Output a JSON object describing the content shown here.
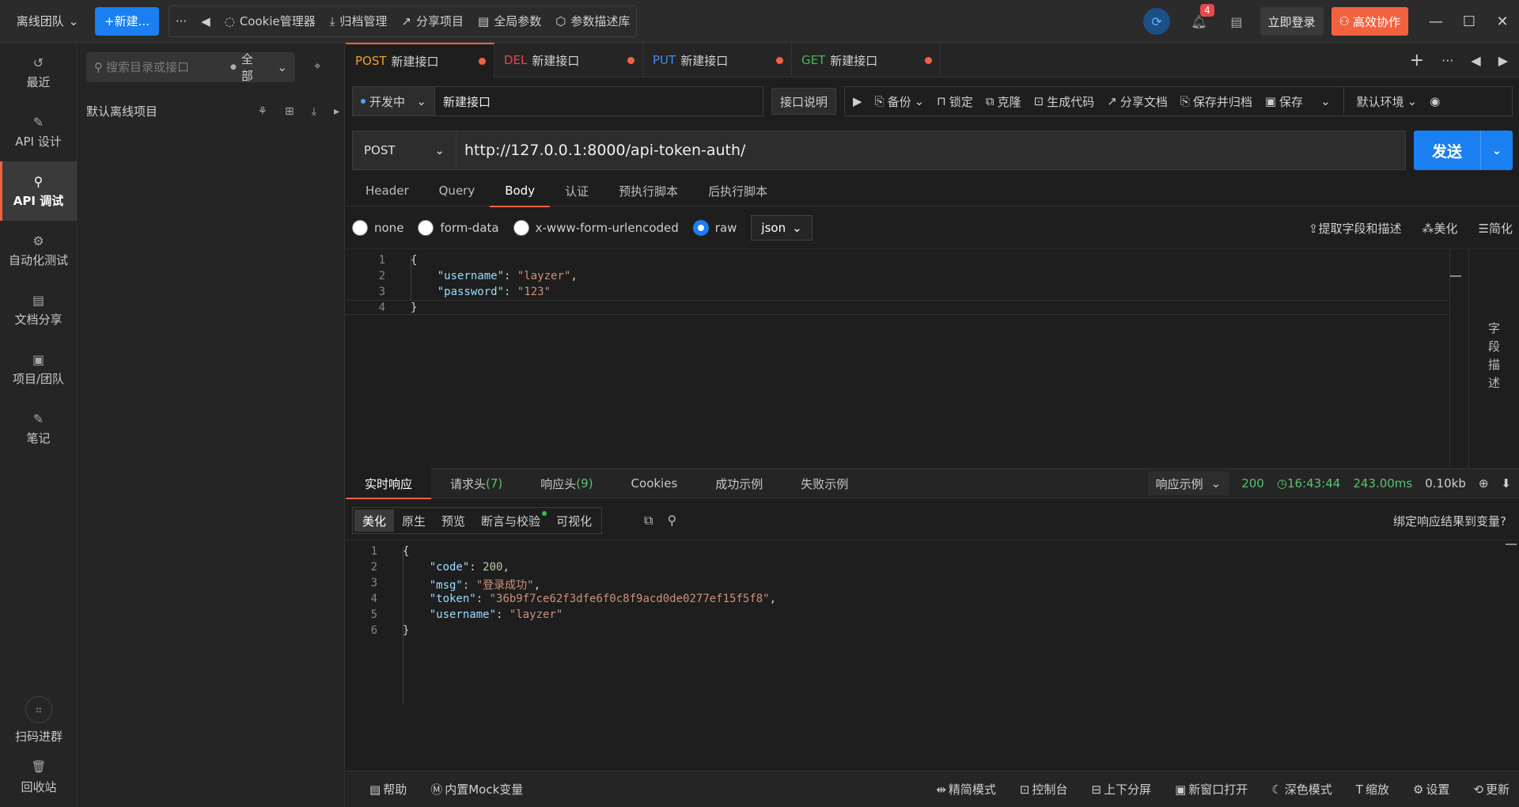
{
  "topbar": {
    "team": "离线团队",
    "new_button": "+新建...",
    "more": "···",
    "back": "◀",
    "tools": [
      {
        "icon": "cookie-icon",
        "glyph": "◌",
        "label": "Cookie管理器"
      },
      {
        "icon": "archive-icon",
        "glyph": "⤓",
        "label": "归档管理"
      },
      {
        "icon": "share-icon",
        "glyph": "↗",
        "label": "分享项目"
      },
      {
        "icon": "params-icon",
        "glyph": "▤",
        "label": "全局参数"
      },
      {
        "icon": "library-icon",
        "glyph": "⬡",
        "label": "参数描述库"
      }
    ],
    "notification_count": "4",
    "login": "立即登录",
    "collab": "高效协作"
  },
  "leftnav": {
    "items": [
      {
        "name": "recent",
        "glyph": "↺",
        "label": "最近"
      },
      {
        "name": "api-design",
        "glyph": "✎",
        "label": "API 设计"
      },
      {
        "name": "api-debug",
        "glyph": "⚲",
        "label": "API 调试"
      },
      {
        "name": "auto-test",
        "glyph": "⚙",
        "label": "自动化测试"
      },
      {
        "name": "doc-share",
        "glyph": "▤",
        "label": "文档分享"
      },
      {
        "name": "project-team",
        "glyph": "▣",
        "label": "项目/团队"
      },
      {
        "name": "notes",
        "glyph": "✎",
        "label": "笔记"
      }
    ],
    "scan": "扫码进群",
    "trash": "回收站"
  },
  "tree": {
    "search_placeholder": "搜索目录或接口",
    "filter": "全部",
    "project": "默认离线项目"
  },
  "tabs": [
    {
      "method": "POST",
      "color": "#f0a030",
      "name": "新建接口"
    },
    {
      "method": "DEL",
      "color": "#e5484d",
      "name": "新建接口"
    },
    {
      "method": "PUT",
      "color": "#3d8ef0",
      "name": "新建接口"
    },
    {
      "method": "GET",
      "color": "#3fb950",
      "name": "新建接口"
    }
  ],
  "request": {
    "status": "开发中",
    "name": "新建接口",
    "desc_button": "接口说明",
    "actions": [
      "备份",
      "锁定",
      "克隆",
      "生成代码",
      "分享文档",
      "保存并归档",
      "保存"
    ],
    "env": "默认环境",
    "method": "POST",
    "url": "http://127.0.0.1:8000/api-token-auth/",
    "send": "发送"
  },
  "param_tabs": [
    "Header",
    "Query",
    "Body",
    "认证",
    "预执行脚本",
    "后执行脚本"
  ],
  "body_types": [
    "none",
    "form-data",
    "x-www-form-urlencoded",
    "raw"
  ],
  "body_format": "json",
  "body_tools": [
    "提取字段和描述",
    "美化",
    "简化"
  ],
  "side_label": "字段描述",
  "request_body": {
    "lines": [
      {
        "n": "1",
        "parts": [
          {
            "t": "{",
            "c": ""
          }
        ]
      },
      {
        "n": "2",
        "parts": [
          {
            "t": "    ",
            "c": ""
          },
          {
            "t": "\"username\"",
            "c": "k"
          },
          {
            "t": ": ",
            "c": ""
          },
          {
            "t": "\"layzer\"",
            "c": "s"
          },
          {
            "t": ",",
            "c": ""
          }
        ]
      },
      {
        "n": "3",
        "parts": [
          {
            "t": "    ",
            "c": ""
          },
          {
            "t": "\"password\"",
            "c": "k"
          },
          {
            "t": ": ",
            "c": ""
          },
          {
            "t": "\"123\"",
            "c": "s"
          }
        ]
      },
      {
        "n": "4",
        "parts": [
          {
            "t": "}",
            "c": ""
          }
        ]
      }
    ]
  },
  "response_tabs": [
    {
      "label": "实时响应",
      "count": ""
    },
    {
      "label": "请求头",
      "count": "(7)"
    },
    {
      "label": "响应头",
      "count": "(9)"
    },
    {
      "label": "Cookies",
      "count": ""
    },
    {
      "label": "成功示例",
      "count": ""
    },
    {
      "label": "失败示例",
      "count": ""
    }
  ],
  "response_meta": {
    "example": "响应示例",
    "status": "200",
    "time": "16:43:44",
    "duration": "243.00ms",
    "size": "0.10kb"
  },
  "response_views": [
    "美化",
    "原生",
    "预览",
    "断言与校验",
    "可视化"
  ],
  "bind_var": "绑定响应结果到变量?",
  "response_body": {
    "lines": [
      {
        "n": "1",
        "parts": [
          {
            "t": "{",
            "c": ""
          }
        ]
      },
      {
        "n": "2",
        "parts": [
          {
            "t": "    ",
            "c": ""
          },
          {
            "t": "\"code\"",
            "c": "k"
          },
          {
            "t": ": ",
            "c": ""
          },
          {
            "t": "200",
            "c": "n"
          },
          {
            "t": ",",
            "c": ""
          }
        ]
      },
      {
        "n": "3",
        "parts": [
          {
            "t": "    ",
            "c": ""
          },
          {
            "t": "\"msg\"",
            "c": "k"
          },
          {
            "t": ": ",
            "c": ""
          },
          {
            "t": "\"登录成功\"",
            "c": "s"
          },
          {
            "t": ",",
            "c": ""
          }
        ]
      },
      {
        "n": "4",
        "parts": [
          {
            "t": "    ",
            "c": ""
          },
          {
            "t": "\"token\"",
            "c": "k"
          },
          {
            "t": ": ",
            "c": ""
          },
          {
            "t": "\"36b9f7ce62f3dfe6f0c8f9acd0de0277ef15f5f8\"",
            "c": "s"
          },
          {
            "t": ",",
            "c": ""
          }
        ]
      },
      {
        "n": "5",
        "parts": [
          {
            "t": "    ",
            "c": ""
          },
          {
            "t": "\"username\"",
            "c": "k"
          },
          {
            "t": ": ",
            "c": ""
          },
          {
            "t": "\"layzer\"",
            "c": "s"
          }
        ]
      },
      {
        "n": "6",
        "parts": [
          {
            "t": "}",
            "c": ""
          }
        ]
      }
    ]
  },
  "statusbar": {
    "left": [
      "帮助",
      "内置Mock变量"
    ],
    "right": [
      "精简模式",
      "控制台",
      "上下分屏",
      "新窗口打开",
      "深色模式",
      "缩放",
      "设置",
      "更新"
    ]
  }
}
